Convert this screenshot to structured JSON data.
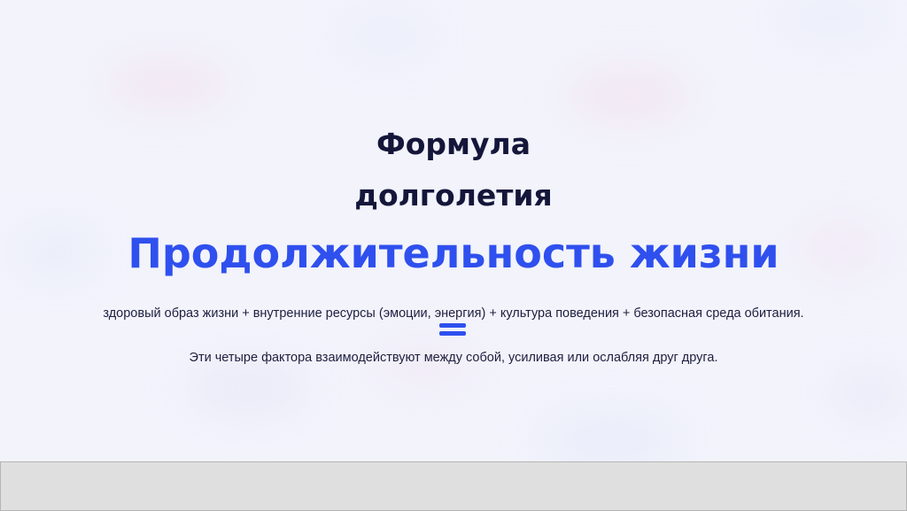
{
  "slide": {
    "title_line1": "Формула",
    "title_line2": "долголетия",
    "headline": "Продолжительность жизни",
    "formula": "здоровый образ жизни + внутренние ресурсы (эмоции, энергия) + культура поведения + безопасная среда обитания.",
    "equals_icon": "equals-sign-icon",
    "note": "Эти четыре фактора взаимодействуют между собой, усиливая или ослабляя друг друга."
  },
  "colors": {
    "background": "#f2f3fb",
    "title": "#14163a",
    "accent": "#2f50ee",
    "text": "#1d1f3e",
    "bottom_bar": "#dfdfdf"
  }
}
